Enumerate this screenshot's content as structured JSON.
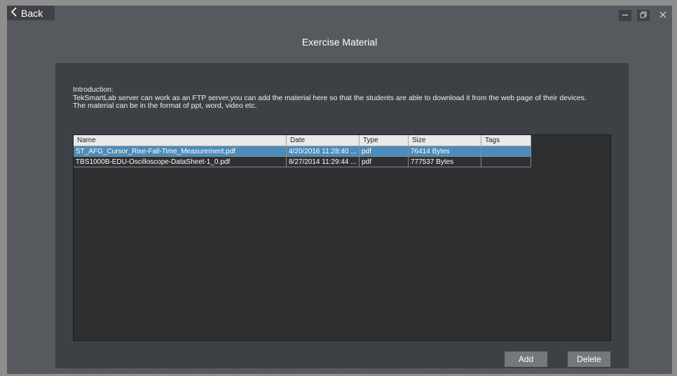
{
  "window": {
    "back_label": "Back",
    "title": "Exercise Material"
  },
  "intro": {
    "heading": "Introduction:",
    "line1": "TekSmartLab server can work as an FTP server,you can add the material here so that the students are able to download it from the web page of their devices.",
    "line2": "The material can be in the format of ppt, word, video etc."
  },
  "table": {
    "columns": [
      "Name",
      "Date",
      "Type",
      "Size",
      "Tags"
    ],
    "rows": [
      {
        "name": "ST_AFG_Cursor_Rise-Fall-Time_Measurement.pdf",
        "date": "4/20/2016 11:28:40 ...",
        "type": "pdf",
        "size": "76414 Bytes",
        "tags": "",
        "selected": true
      },
      {
        "name": "TBS1000B-EDU-Oscilloscope-DataSheet-1_0.pdf",
        "date": "8/27/2014 11:29:44 ...",
        "type": "pdf",
        "size": "777537 Bytes",
        "tags": "",
        "selected": false
      }
    ]
  },
  "actions": {
    "add_label": "Add",
    "delete_label": "Delete"
  },
  "icons": {
    "back": "chevron-left-icon",
    "minimize": "minimize-icon",
    "maximize": "restore-icon",
    "close": "close-icon"
  },
  "colors": {
    "selected_row": "#4a8cbb",
    "panel": "#3d4145",
    "window": "#565a5e"
  }
}
